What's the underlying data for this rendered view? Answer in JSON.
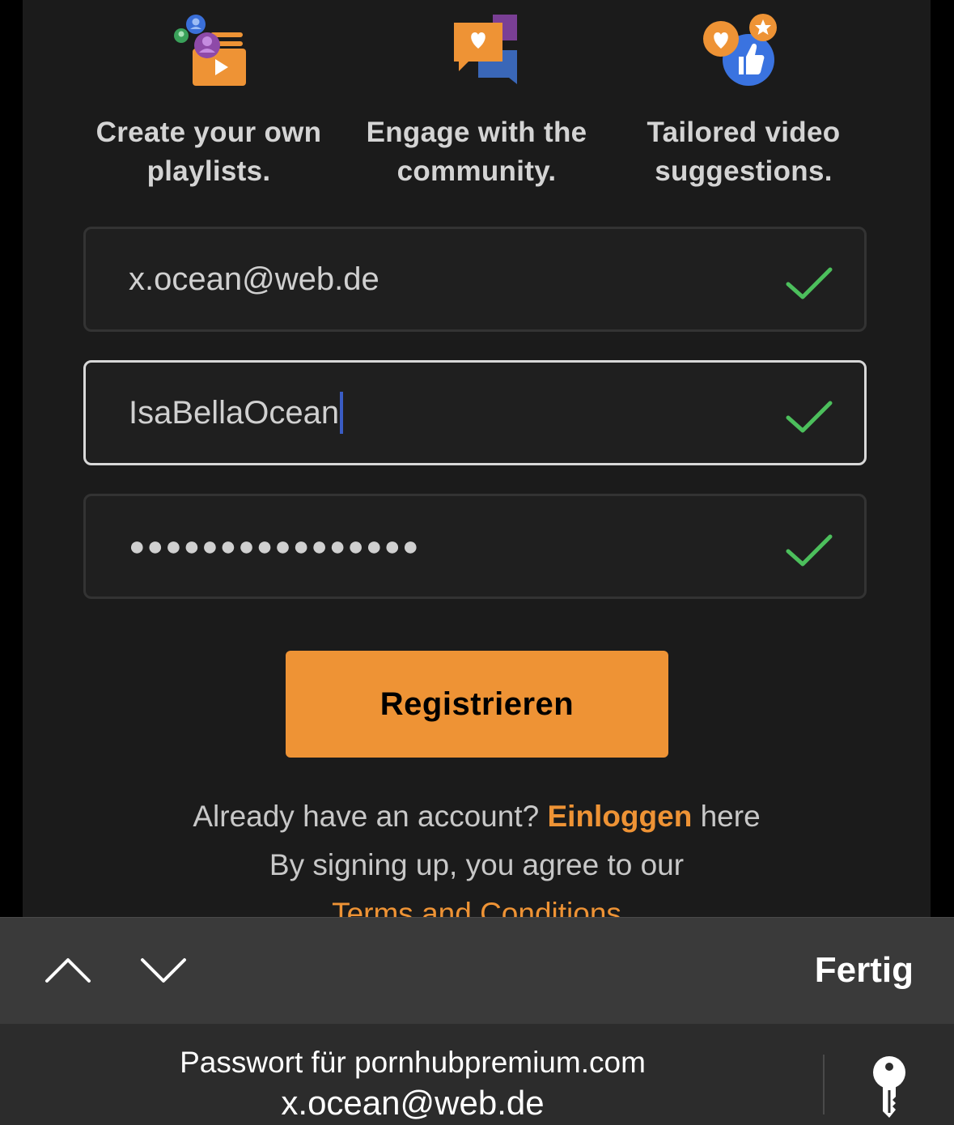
{
  "features": [
    {
      "icon": "playlist-icon",
      "caption_line1": "Create your own",
      "caption_line2": "playlists."
    },
    {
      "icon": "chat-bubbles-icon",
      "caption_line1": "Engage with the",
      "caption_line2": "community."
    },
    {
      "icon": "thumbs-up-icon",
      "caption_line1": "Tailored video",
      "caption_line2": "suggestions."
    }
  ],
  "form": {
    "email_value": "x.ocean@web.de",
    "username_value": "IsaBellaOcean",
    "password_masked": "●●●●●●●●●●●●●●●●",
    "register_label": "Registrieren",
    "already_prefix": "Already have an account? ",
    "login_link": "Einloggen",
    "already_suffix": " here",
    "agree_text": "By signing up, you agree to our",
    "terms_link": "Terms and Conditions"
  },
  "keyboard_toolbar": {
    "done_label": "Fertig"
  },
  "autofill": {
    "line1": "Passwort für pornhubpremium.com",
    "line2": "x.ocean@web.de"
  },
  "colors": {
    "accent": "#ee9335",
    "check": "#4cbf5c",
    "background": "#1b1b1b"
  }
}
